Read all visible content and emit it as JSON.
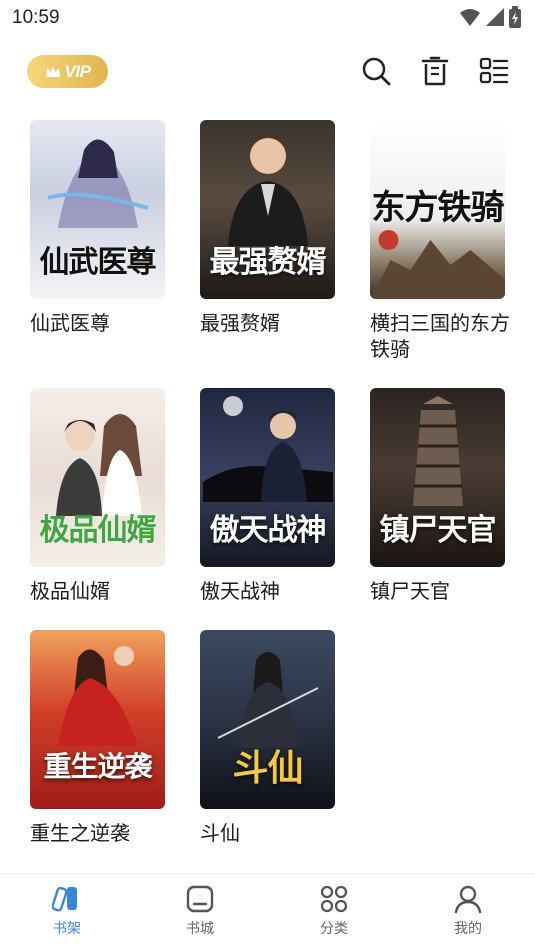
{
  "status_bar": {
    "time": "10:59"
  },
  "header": {
    "vip_label": "VIP"
  },
  "books": [
    {
      "title": "仙武医尊",
      "cover_text": "仙武医尊"
    },
    {
      "title": "最强赘婿",
      "cover_text": "最强赘婿"
    },
    {
      "title": "横扫三国的东方铁骑",
      "cover_text": "东方铁骑"
    },
    {
      "title": "极品仙婿",
      "cover_text": "极品仙婿"
    },
    {
      "title": "傲天战神",
      "cover_text": "傲天战神"
    },
    {
      "title": "镇尸天官",
      "cover_text": "镇尸天官"
    },
    {
      "title": "重生之逆袭",
      "cover_text": "重生逆袭"
    },
    {
      "title": "斗仙",
      "cover_text": "斗仙"
    }
  ],
  "bottom_nav": [
    {
      "label": "书架",
      "icon": "bookshelf-icon",
      "active": true
    },
    {
      "label": "书城",
      "icon": "bookstore-icon",
      "active": false
    },
    {
      "label": "分类",
      "icon": "category-icon",
      "active": false
    },
    {
      "label": "我的",
      "icon": "profile-icon",
      "active": false
    }
  ],
  "colors": {
    "accent": "#3a86d6",
    "vip_gold": "#e2b44f",
    "text": "#1c1c1c"
  }
}
